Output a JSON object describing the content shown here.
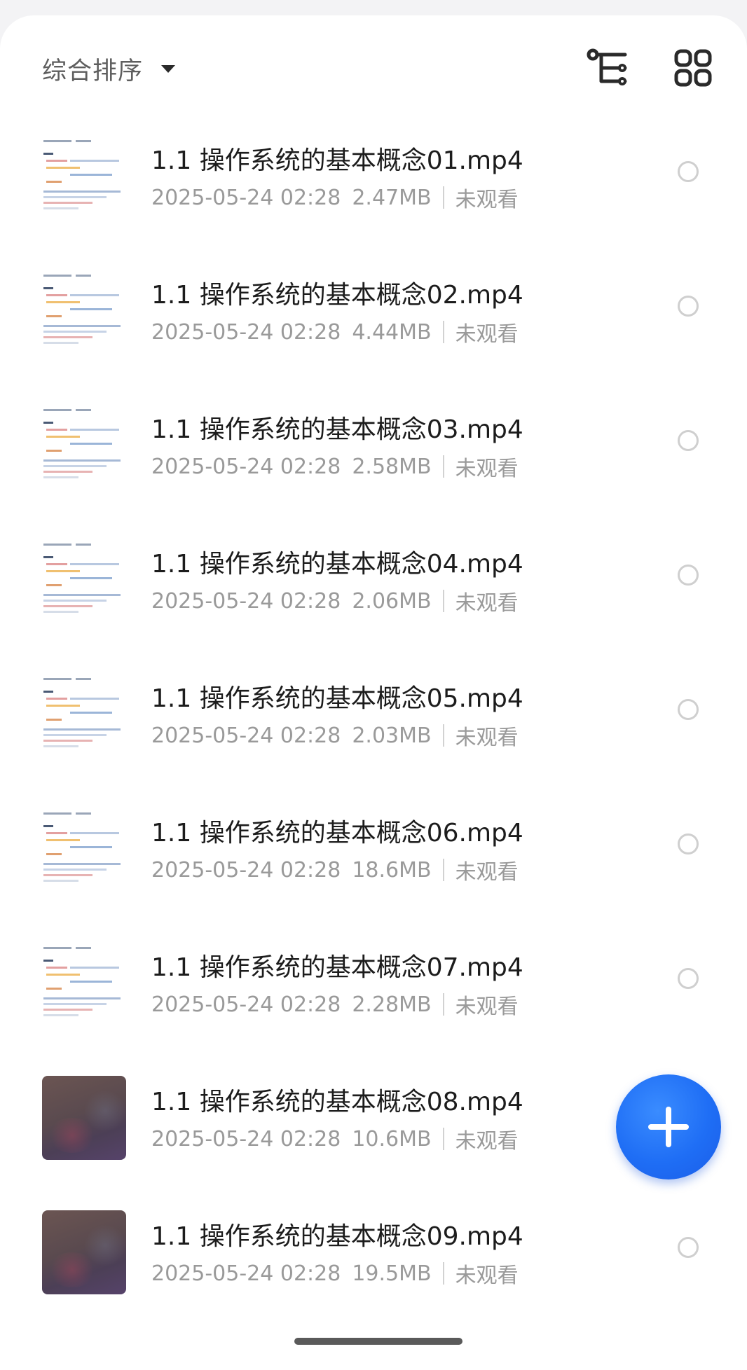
{
  "toolbar": {
    "sort_label": "综合排序",
    "icons": [
      "tree-view-icon",
      "grid-view-icon"
    ]
  },
  "files": [
    {
      "name": "1.1 操作系统的基本概念01.mp4",
      "date": "2025-05-24 02:28",
      "size": "2.47MB",
      "status": "未观看",
      "thumb": "slide"
    },
    {
      "name": "1.1 操作系统的基本概念02.mp4",
      "date": "2025-05-24 02:28",
      "size": "4.44MB",
      "status": "未观看",
      "thumb": "slide"
    },
    {
      "name": "1.1 操作系统的基本概念03.mp4",
      "date": "2025-05-24 02:28",
      "size": "2.58MB",
      "status": "未观看",
      "thumb": "slide"
    },
    {
      "name": "1.1 操作系统的基本概念04.mp4",
      "date": "2025-05-24 02:28",
      "size": "2.06MB",
      "status": "未观看",
      "thumb": "slide"
    },
    {
      "name": "1.1 操作系统的基本概念05.mp4",
      "date": "2025-05-24 02:28",
      "size": "2.03MB",
      "status": "未观看",
      "thumb": "slide"
    },
    {
      "name": "1.1 操作系统的基本概念06.mp4",
      "date": "2025-05-24 02:28",
      "size": "18.6MB",
      "status": "未观看",
      "thumb": "slide"
    },
    {
      "name": "1.1 操作系统的基本概念07.mp4",
      "date": "2025-05-24 02:28",
      "size": "2.28MB",
      "status": "未观看",
      "thumb": "slide"
    },
    {
      "name": "1.1 操作系统的基本概念08.mp4",
      "date": "2025-05-24 02:28",
      "size": "10.6MB",
      "status": "未观看",
      "thumb": "dark"
    },
    {
      "name": "1.1 操作系统的基本概念09.mp4",
      "date": "2025-05-24 02:28",
      "size": "19.5MB",
      "status": "未观看",
      "thumb": "dark"
    }
  ],
  "fab": {
    "icon": "plus-icon"
  },
  "colors": {
    "accent": "#1f6ef5",
    "title_text": "#1c1c1c",
    "meta_text": "#9a9a9a"
  }
}
